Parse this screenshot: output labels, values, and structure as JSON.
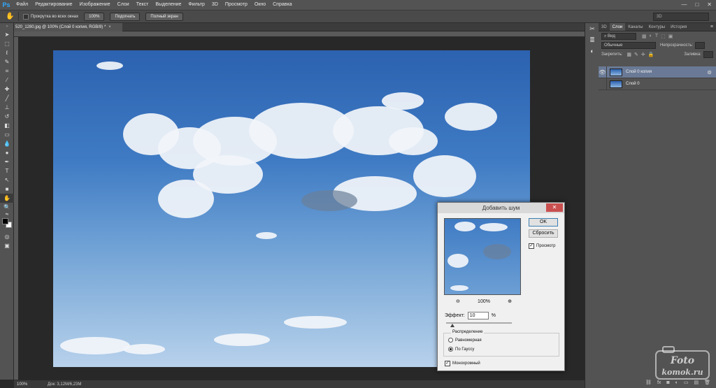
{
  "app": {
    "logo": "Ps"
  },
  "menu": [
    "Файл",
    "Редактирование",
    "Изображение",
    "Слои",
    "Текст",
    "Выделение",
    "Фильтр",
    "3D",
    "Просмотр",
    "Окно",
    "Справка"
  ],
  "window_controls": [
    "—",
    "□",
    "✕"
  ],
  "options_bar": {
    "scroll_all_label": "Прокрутка во всех окнах",
    "zoom_100": "100%",
    "fit_screen": "Подогнать",
    "full_screen": "Полный экран",
    "workspace": "3D"
  },
  "document": {
    "tab_title": "520_1280.jpg @ 100% (Слой 0 копия, RGB/8) *",
    "tab_close": "×",
    "zoom": "100%",
    "doc_size": "Док: 3,12M/6,23M"
  },
  "layers_panel": {
    "tabs": [
      "3D",
      "Слои",
      "Каналы",
      "Контуры",
      "История"
    ],
    "active_tab": "Слои",
    "filter_label": "Вид",
    "blend_mode": "Обычные",
    "opacity_label": "Непрозрачность:",
    "opacity_value": "",
    "lock_label": "Закрепить:",
    "fill_label": "Заливка:",
    "fill_value": "",
    "layers": [
      {
        "name": "Слой 0 копия",
        "visible": true,
        "selected": true
      },
      {
        "name": "Слой 0",
        "visible": false,
        "selected": false
      }
    ]
  },
  "dialog": {
    "title": "Добавить шум",
    "ok": "OK",
    "cancel": "Сбросить",
    "preview_label": "Просмотр",
    "preview_checked": true,
    "zoom": "100%",
    "amount_label": "Эффект:",
    "amount_value": "10",
    "amount_unit": "%",
    "amount_fraction": 0.1,
    "distribution_label": "Распределение",
    "uniform_label": "Равномерная",
    "gaussian_label": "По Гауссу",
    "selected_distribution": "gaussian",
    "monochrome_label": "Монохромный",
    "monochrome_checked": true
  },
  "watermark": {
    "line1": "Foto",
    "line2": "komok.ru"
  },
  "colors": {
    "accent": "#31a8ff",
    "close_red": "#c94f4f",
    "selected_layer": "#6a7a96"
  }
}
